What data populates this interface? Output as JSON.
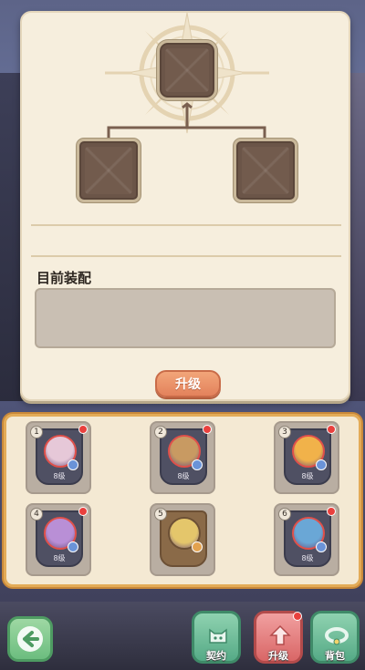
{
  "panel": {
    "section_title": "目前装配",
    "upgrade_label": "升级"
  },
  "heroes": [
    {
      "index": "1",
      "level": "8级",
      "portrait_color": "#e6c8d8",
      "has_alert": true
    },
    {
      "index": "2",
      "level": "8级",
      "portrait_color": "#c89a62",
      "has_alert": true
    },
    {
      "index": "3",
      "level": "8级",
      "portrait_color": "#f1b24a",
      "has_alert": true
    },
    {
      "index": "4",
      "level": "8级",
      "portrait_color": "#b98fd6",
      "has_alert": true
    },
    {
      "index": "5",
      "level": "",
      "portrait_color": "#e4c66b",
      "has_alert": false
    },
    {
      "index": "6",
      "level": "8级",
      "portrait_color": "#6aa7d6",
      "has_alert": true
    }
  ],
  "nav": {
    "contract": "契约",
    "upgrade": "升级",
    "bag": "背包"
  },
  "icons": {
    "back": "back-arrow-icon",
    "contract": "cat-contract-icon",
    "upgrade": "upgrade-arrow-icon",
    "bag": "bag-collar-icon"
  },
  "colors": {
    "accent_orange": "#e3825c",
    "panel_bg": "#f6eedd",
    "alert_red": "#e9403d",
    "nav_green": "#55aa86",
    "nav_red": "#d96666"
  }
}
